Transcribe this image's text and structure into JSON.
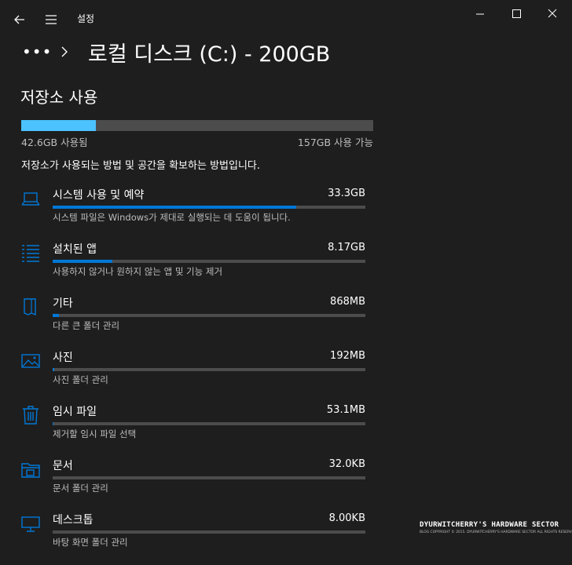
{
  "window": {
    "title": "설정",
    "breadcrumb_ellipsis": "•••",
    "page_title": "로컬 디스크 (C:) - 200GB"
  },
  "storage": {
    "section_title": "저장소 사용",
    "used_fraction": 0.213,
    "used_label": "42.6GB 사용됨",
    "free_label": "157GB 사용 가능",
    "description": "저장소가 사용되는 방법 및 공간을 확보하는 방법입니다."
  },
  "categories": [
    {
      "icon": "laptop-icon",
      "name": "시스템 사용 및 예약",
      "size": "33.3GB",
      "subtitle": "시스템 파일은 Windows가 제대로 실행되는 데 도움이 됩니다.",
      "fraction": 0.78
    },
    {
      "icon": "apps-list-icon",
      "name": "설치된 앱",
      "size": "8.17GB",
      "subtitle": "사용하지 않거나 원하지 않는 앱 및 기능 제거",
      "fraction": 0.19
    },
    {
      "icon": "other-folder-icon",
      "name": "기타",
      "size": "868MB",
      "subtitle": "다른 큰 폴더 관리",
      "fraction": 0.02
    },
    {
      "icon": "picture-icon",
      "name": "사진",
      "size": "192MB",
      "subtitle": "사진 폴더 관리",
      "fraction": 0.004
    },
    {
      "icon": "trash-icon",
      "name": "임시 파일",
      "size": "53.1MB",
      "subtitle": "제거할 임시 파일 선택",
      "fraction": 0.0015
    },
    {
      "icon": "documents-folder-icon",
      "name": "문서",
      "size": "32.0KB",
      "subtitle": "문서 폴더 관리",
      "fraction": 0
    },
    {
      "icon": "desktop-monitor-icon",
      "name": "데스크톱",
      "size": "8.00KB",
      "subtitle": "바탕 화면 폴더 관리",
      "fraction": 0
    }
  ],
  "colors": {
    "background": "#1e1e1e",
    "total_bar_fill": "#4cc2ff",
    "category_bar_fill": "#0078d7",
    "bar_track": "#4c4c4c",
    "icon": "#0078d7"
  },
  "watermark": {
    "title": "DYURWITCHERRY'S HARDWARE SECTOR",
    "subtitle": "BLOG COPYRIGHT © 2015. DYURWITCHERRY'S HARDWARE SECTOR ALL RIGHTS RESERVED."
  }
}
